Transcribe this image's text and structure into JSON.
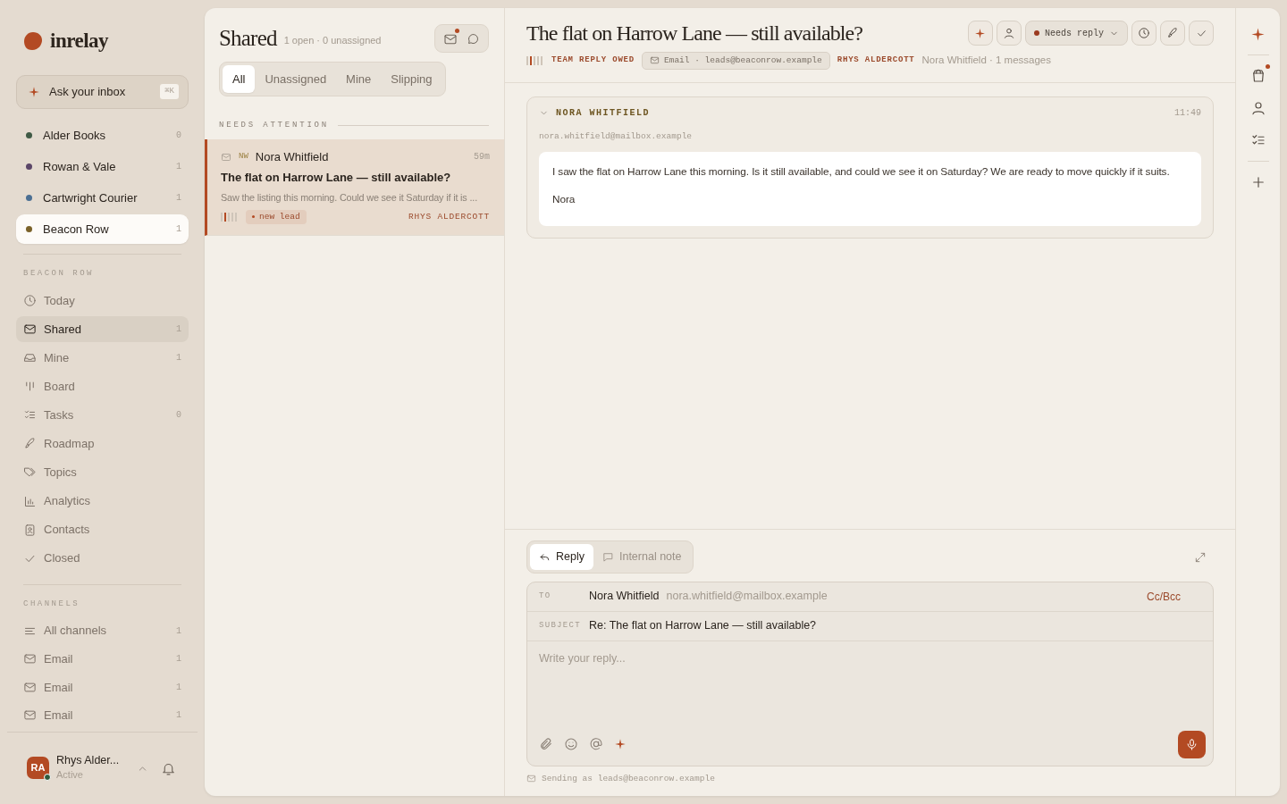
{
  "brand": {
    "name": "inrelay"
  },
  "ask": {
    "label": "Ask your inbox",
    "shortcut": "⌘K"
  },
  "workspaces": [
    {
      "name": "Alder Books",
      "count": "0",
      "color": "#3f5a45",
      "selected": false
    },
    {
      "name": "Rowan & Vale",
      "count": "1",
      "color": "#5b4668",
      "selected": false
    },
    {
      "name": "Cartwright Courier",
      "count": "1",
      "color": "#4b6f93",
      "selected": false
    },
    {
      "name": "Beacon Row",
      "count": "1",
      "color": "#7a6128",
      "selected": true
    }
  ],
  "section_label": "BEACON ROW",
  "nav": [
    {
      "label": "Today",
      "selected": false
    },
    {
      "label": "Shared",
      "count": "1",
      "selected": true
    },
    {
      "label": "Mine",
      "count": "1",
      "selected": false
    },
    {
      "label": "Board",
      "selected": false
    },
    {
      "label": "Tasks",
      "count": "0",
      "selected": false
    },
    {
      "label": "Roadmap",
      "selected": false
    },
    {
      "label": "Topics",
      "selected": false
    },
    {
      "label": "Analytics",
      "selected": false
    },
    {
      "label": "Contacts",
      "selected": false
    },
    {
      "label": "Closed",
      "selected": false
    }
  ],
  "channels_label": "CHANNELS",
  "channels": [
    {
      "label": "All channels",
      "count": "1"
    },
    {
      "label": "Email",
      "count": "1"
    },
    {
      "label": "Email",
      "count": "1"
    },
    {
      "label": "Email",
      "count": "1"
    }
  ],
  "user": {
    "name": "Rhys Alder...",
    "initials": "RA",
    "status": "Active",
    "online": true
  },
  "list": {
    "title": "Shared",
    "summary": "1 open · 0 unassigned",
    "unread": true,
    "filters": [
      {
        "label": "All",
        "selected": true
      },
      {
        "label": "Unassigned",
        "selected": false
      },
      {
        "label": "Mine",
        "selected": false
      },
      {
        "label": "Slipping",
        "selected": false
      }
    ],
    "section": "NEEDS ATTENTION",
    "conversations": [
      {
        "initials": "NW",
        "sender": "Nora Whitfield",
        "time": "59m",
        "subject": "The flat on Harrow Lane — still available?",
        "preview": "Saw the listing this morning. Could we see it Saturday if it is ...",
        "tag": "new lead",
        "assignee": "RHYS ALDERCOTT",
        "selected": true
      }
    ]
  },
  "thread": {
    "title": "The flat on Harrow Lane — still available?",
    "state": "TEAM REPLY OWED",
    "channel": "Email · leads@beaconrow.example",
    "assignee": "RHYS ALDERCOTT",
    "meta": "Nora Whitfield · 1 messages",
    "status": "Needs reply",
    "messages": [
      {
        "sender": "NORA WHITFIELD",
        "time": "11:49",
        "address": "nora.whitfield@mailbox.example",
        "expanded": true,
        "paragraphs": [
          "I saw the flat on Harrow Lane this morning. Is it still available, and could we see it on Saturday? We are ready to move quickly if it suits.",
          "Nora"
        ]
      }
    ]
  },
  "composer": {
    "modes": [
      {
        "label": "Reply",
        "selected": true
      },
      {
        "label": "Internal note",
        "selected": false
      }
    ],
    "to_label": "TO",
    "to_name": "Nora Whitfield",
    "to_address": "nora.whitfield@mailbox.example",
    "cc": "Cc/Bcc",
    "subject_label": "SUBJECT",
    "subject": "Re: The flat on Harrow Lane — still available?",
    "placeholder": "Write your reply...",
    "sending_as": "Sending as leads@beaconrow.example"
  },
  "rail": {
    "notification": true
  }
}
